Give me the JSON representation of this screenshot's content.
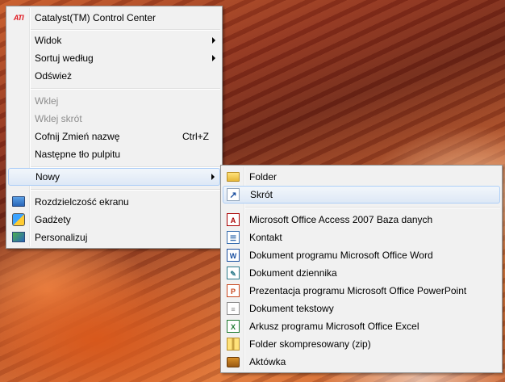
{
  "context_menu": {
    "catalyst": "Catalyst(TM) Control Center",
    "catalyst_icon_text": "ATI",
    "widok": "Widok",
    "sortuj": "Sortuj według",
    "odswiez": "Odśwież",
    "wklej": "Wklej",
    "wklej_skrot": "Wklej skrót",
    "cofnij": "Cofnij Zmień nazwę",
    "cofnij_shortcut": "Ctrl+Z",
    "nastepne_tlo": "Następne tło pulpitu",
    "nowy": "Nowy",
    "rozdzielczosc": "Rozdzielczość ekranu",
    "gadzety": "Gadżety",
    "personalizuj": "Personalizuj"
  },
  "new_submenu": {
    "items": [
      {
        "label": "Folder",
        "icon": "folder-icon"
      },
      {
        "label": "Skrót",
        "icon": "shortcut-icon"
      },
      {
        "label": "Microsoft Office Access 2007 Baza danych",
        "icon": "access-icon"
      },
      {
        "label": "Kontakt",
        "icon": "contact-icon"
      },
      {
        "label": "Dokument programu Microsoft Office Word",
        "icon": "word-icon"
      },
      {
        "label": "Dokument dziennika",
        "icon": "journal-icon"
      },
      {
        "label": "Prezentacja programu Microsoft Office PowerPoint",
        "icon": "powerpoint-icon"
      },
      {
        "label": "Dokument tekstowy",
        "icon": "text-document-icon"
      },
      {
        "label": "Arkusz programu Microsoft Office Excel",
        "icon": "excel-icon"
      },
      {
        "label": "Folder skompresowany (zip)",
        "icon": "zip-folder-icon"
      },
      {
        "label": "Aktówka",
        "icon": "briefcase-icon"
      }
    ]
  }
}
